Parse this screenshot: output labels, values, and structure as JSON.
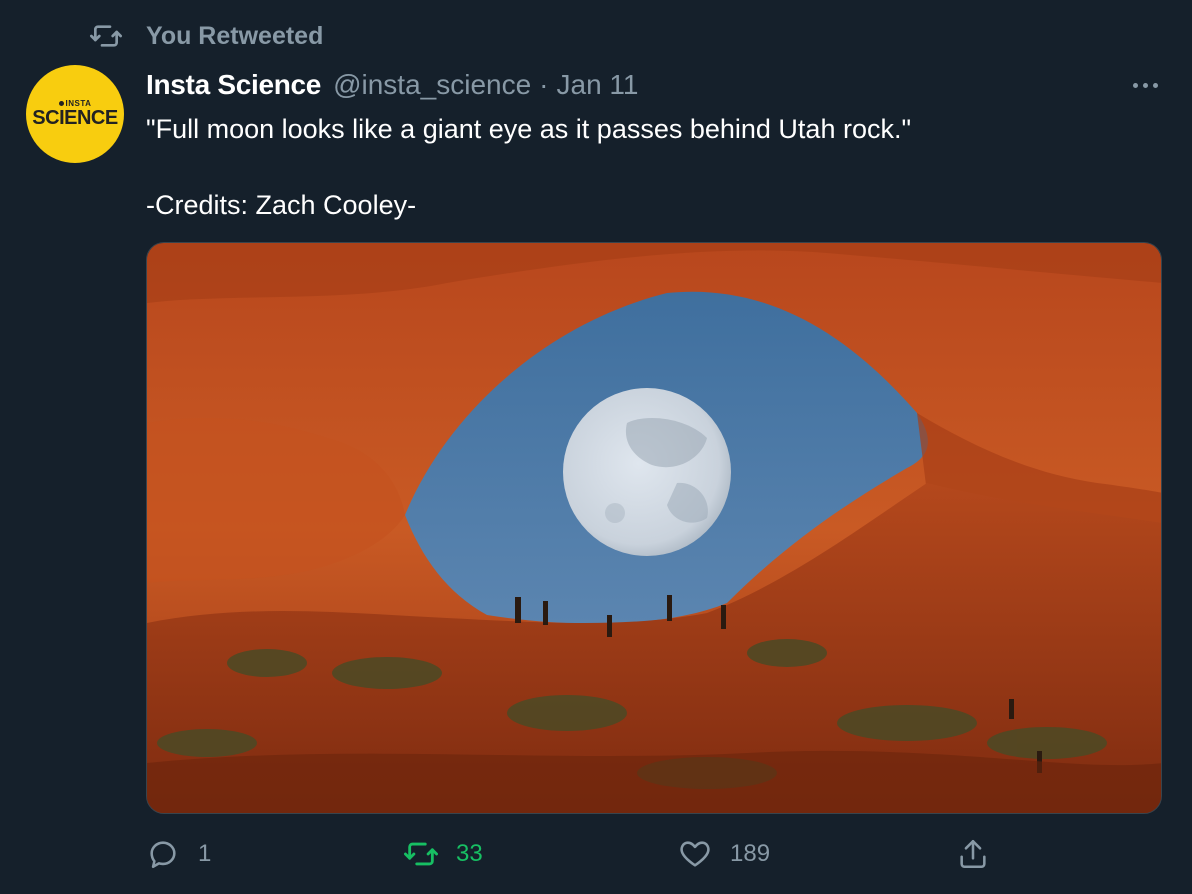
{
  "context": {
    "label": "You Retweeted",
    "icon": "retweet-icon"
  },
  "author": {
    "avatar_top": "INSTA",
    "avatar_main": "SCIENCE",
    "avatar_color": "#f8cd0f",
    "name": "Insta Science",
    "handle": "@insta_science",
    "separator": "·",
    "date": "Jan 11"
  },
  "tweet": {
    "text": "\"Full moon looks like a giant eye as it passes behind Utah rock.\"\n\n-Credits: Zach Cooley-"
  },
  "media": {
    "icon": "photo-arch-moon"
  },
  "actions": {
    "reply_count": "1",
    "retweet_count": "33",
    "like_count": "189",
    "retweet_active_color": "#17bf63"
  },
  "theme": {
    "background": "#15202b",
    "muted": "#8899a6",
    "text": "#ffffff"
  }
}
